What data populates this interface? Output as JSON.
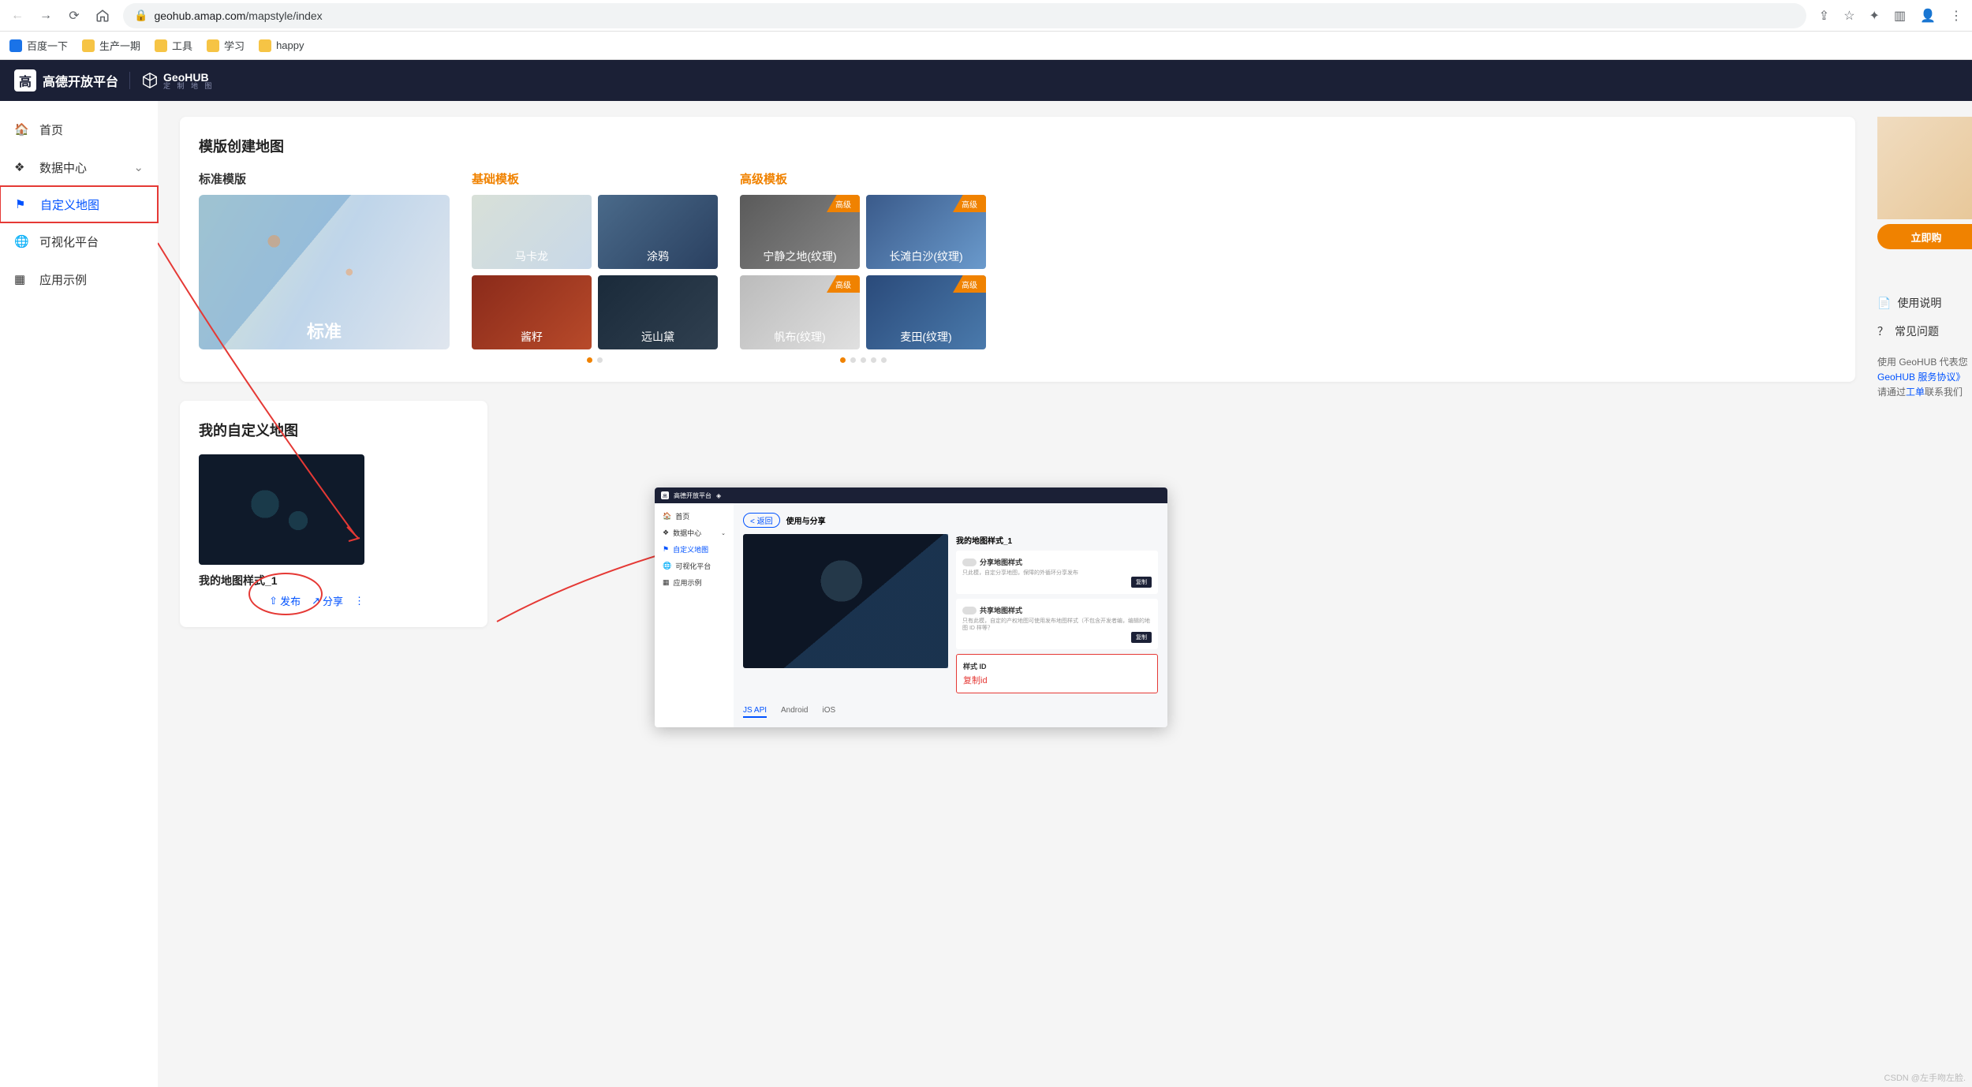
{
  "browser": {
    "url_domain": "geohub.amap.com",
    "url_path": "/mapstyle/index"
  },
  "bookmarks": [
    {
      "icon": "blue",
      "label": "百度一下"
    },
    {
      "icon": "folder",
      "label": "生产一期"
    },
    {
      "icon": "folder",
      "label": "工具"
    },
    {
      "icon": "folder",
      "label": "学习"
    },
    {
      "icon": "folder",
      "label": "happy"
    }
  ],
  "header": {
    "brand": "高德开放平台",
    "geohub_title": "GeoHUB",
    "geohub_sub": "定 制 地 图"
  },
  "sidebar": [
    {
      "icon": "home",
      "label": "首页"
    },
    {
      "icon": "layers",
      "label": "数据中心",
      "chevron": true
    },
    {
      "icon": "map",
      "label": "自定义地图",
      "active": true
    },
    {
      "icon": "globe",
      "label": "可视化平台"
    },
    {
      "icon": "grid",
      "label": "应用示例"
    }
  ],
  "panel1": {
    "title": "模版创建地图",
    "cols": {
      "std": {
        "title": "标准模版",
        "card": "标准"
      },
      "basic": {
        "title": "基础模板",
        "cards": [
          "马卡龙",
          "涂鸦",
          "酱籽",
          "远山黛"
        ]
      },
      "adv": {
        "title": "高级模板",
        "badge": "高级",
        "cards": [
          "宁静之地(纹理)",
          "长滩白沙(纹理)",
          "帆布(纹理)",
          "麦田(纹理)"
        ]
      }
    }
  },
  "panel2": {
    "title": "我的自定义地图",
    "card_title": "我的地图样式_1",
    "actions": {
      "publish": "发布",
      "share": "分享"
    }
  },
  "right": {
    "cta": "立即购",
    "link1": "使用说明",
    "link2": "常见问题",
    "text1": "使用 GeoHUB 代表您",
    "link_agree": "GeoHUB 服务协议》",
    "text2_a": "请通过",
    "text2_link": "工单",
    "text2_b": "联系我们"
  },
  "embed": {
    "brand": "高德开放平台",
    "sidebar": [
      {
        "label": "首页"
      },
      {
        "label": "数据中心",
        "chevron": true
      },
      {
        "label": "自定义地图",
        "active": true
      },
      {
        "label": "可视化平台"
      },
      {
        "label": "应用示例"
      }
    ],
    "back": "< 返回",
    "crumb": "使用与分享",
    "my_title": "我的地图样式_1",
    "block1": {
      "title": "分享地图样式",
      "desc": "只此模，自定分享地图，保障的外循环分享发布",
      "copy": "复制"
    },
    "block2": {
      "title": "共享地图样式",
      "desc": "只有此模，自定的产权地图可使用发布地图样式（不包含开发者编，编辑的地图 ID 样等？",
      "copy": "复制"
    },
    "block3": {
      "title": "样式 ID",
      "value": "复制id"
    },
    "tabs": [
      "JS API",
      "Android",
      "iOS"
    ]
  },
  "watermark": "CSDN @左手吻左脸."
}
